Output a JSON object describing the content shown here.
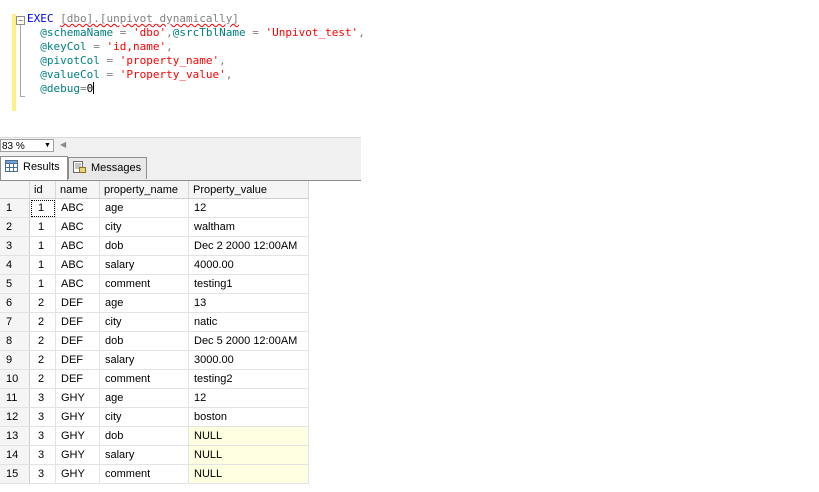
{
  "editor": {
    "collapse_symbol": "−",
    "lines": [
      {
        "exec": "EXEC ",
        "proc": "[dbo].[unpivot_dynamically]"
      },
      {
        "p1": "@schemaName",
        "eq1": " = ",
        "v1": "'dbo'",
        "comma1": ",",
        "p2": "@srcTblName",
        "eq2": " = ",
        "v2": "'Unpivot_test'",
        "end": ","
      },
      {
        "p": "@keyCol",
        "eq": " = ",
        "v": "'id,name'",
        "end": ","
      },
      {
        "p": "@pivotCol",
        "eq": " = ",
        "v": "'property_name'",
        "end": ","
      },
      {
        "p": "@valueCol",
        "eq": " = ",
        "v": "'Property_value'",
        "end": ","
      },
      {
        "p": "@debug",
        "eq": "=",
        "v": "0"
      }
    ]
  },
  "zoom": {
    "value": "83 %"
  },
  "tabs": {
    "results": "Results",
    "messages": "Messages"
  },
  "grid": {
    "columns": [
      "id",
      "name",
      "property_name",
      "Property_value"
    ],
    "rows": [
      {
        "n": "1",
        "id": "1",
        "name": "ABC",
        "prop": "age",
        "val": "12"
      },
      {
        "n": "2",
        "id": "1",
        "name": "ABC",
        "prop": "city",
        "val": "waltham"
      },
      {
        "n": "3",
        "id": "1",
        "name": "ABC",
        "prop": "dob",
        "val": "Dec  2 2000 12:00AM"
      },
      {
        "n": "4",
        "id": "1",
        "name": "ABC",
        "prop": "salary",
        "val": "4000.00"
      },
      {
        "n": "5",
        "id": "1",
        "name": "ABC",
        "prop": "comment",
        "val": "testing1"
      },
      {
        "n": "6",
        "id": "2",
        "name": "DEF",
        "prop": "age",
        "val": "13"
      },
      {
        "n": "7",
        "id": "2",
        "name": "DEF",
        "prop": "city",
        "val": "natic"
      },
      {
        "n": "8",
        "id": "2",
        "name": "DEF",
        "prop": "dob",
        "val": "Dec  5 2000 12:00AM"
      },
      {
        "n": "9",
        "id": "2",
        "name": "DEF",
        "prop": "salary",
        "val": "3000.00"
      },
      {
        "n": "10",
        "id": "2",
        "name": "DEF",
        "prop": "comment",
        "val": "testing2"
      },
      {
        "n": "11",
        "id": "3",
        "name": "GHY",
        "prop": "age",
        "val": "12"
      },
      {
        "n": "12",
        "id": "3",
        "name": "GHY",
        "prop": "city",
        "val": "boston"
      },
      {
        "n": "13",
        "id": "3",
        "name": "GHY",
        "prop": "dob",
        "val": "NULL"
      },
      {
        "n": "14",
        "id": "3",
        "name": "GHY",
        "prop": "salary",
        "val": "NULL"
      },
      {
        "n": "15",
        "id": "3",
        "name": "GHY",
        "prop": "comment",
        "val": "NULL"
      }
    ]
  },
  "colors": {
    "null_cell": "#ffffe1",
    "keyword": "#0000ff",
    "string": "#ff0000",
    "parameter": "#008080"
  }
}
